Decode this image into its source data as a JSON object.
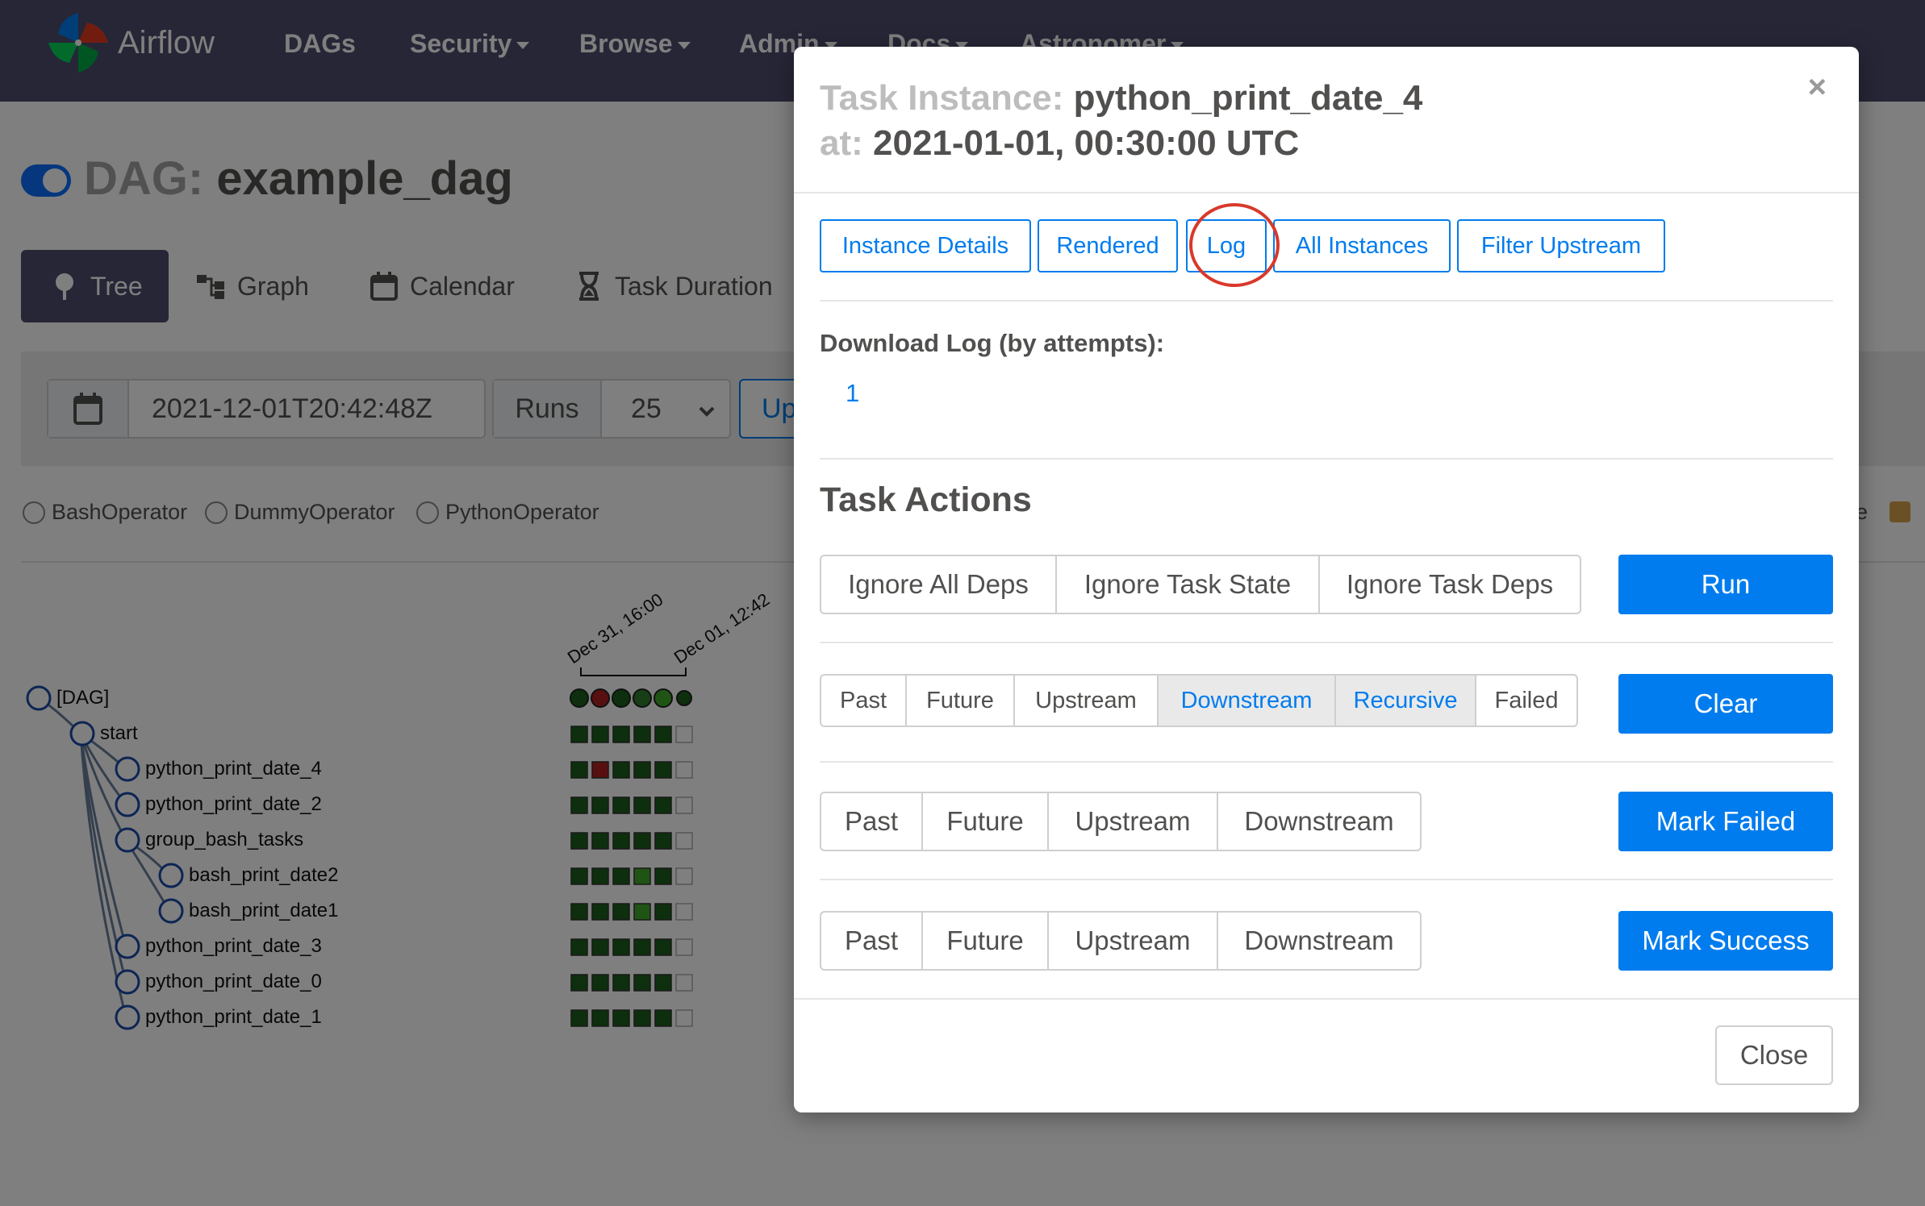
{
  "navbar": {
    "brand": "Airflow",
    "items": [
      "DAGs",
      "Security",
      "Browse",
      "Admin",
      "Docs",
      "Astronomer"
    ]
  },
  "dag": {
    "label": "DAG:",
    "name": "example_dag"
  },
  "views": [
    "Tree",
    "Graph",
    "Calendar",
    "Task Duration"
  ],
  "filter": {
    "base_date": "2021-12-01T20:42:48Z",
    "runs_label": "Runs",
    "runs_value": "25",
    "update_label": "Update"
  },
  "legend": [
    "BashOperator",
    "DummyOperator",
    "PythonOperator"
  ],
  "legend_right": "e",
  "tree": {
    "date_labels": [
      "Dec 31, 16:00",
      "Dec 01, 12:42"
    ],
    "nodes": [
      "[DAG]",
      "start",
      "python_print_date_4",
      "python_print_date_2",
      "group_bash_tasks",
      "bash_print_date2",
      "bash_print_date1",
      "python_print_date_3",
      "python_print_date_0",
      "python_print_date_1"
    ]
  },
  "colors": {
    "navbar": "#4c4d6e",
    "primary": "#017cee",
    "success": "#1a5f1a",
    "failed": "#b01f1f",
    "running": "#40a829",
    "annotation": "#d8392b"
  },
  "modal": {
    "title_label": "Task Instance:",
    "task_id": "python_print_date_4",
    "at_label": "at:",
    "execution_date": "2021-01-01, 00:30:00 UTC",
    "close_x": "×",
    "tabs": [
      "Instance Details",
      "Rendered",
      "Log",
      "All Instances",
      "Filter Upstream"
    ],
    "download_label": "Download Log (by attempts):",
    "attempts": [
      "1"
    ],
    "task_actions_title": "Task Actions",
    "run": {
      "options": [
        "Ignore All Deps",
        "Ignore Task State",
        "Ignore Task Deps"
      ],
      "button": "Run"
    },
    "clear": {
      "options": [
        "Past",
        "Future",
        "Upstream",
        "Downstream",
        "Recursive",
        "Failed"
      ],
      "active": [
        "Downstream",
        "Recursive"
      ],
      "button": "Clear"
    },
    "mark_failed": {
      "options": [
        "Past",
        "Future",
        "Upstream",
        "Downstream"
      ],
      "button": "Mark Failed"
    },
    "mark_success": {
      "options": [
        "Past",
        "Future",
        "Upstream",
        "Downstream"
      ],
      "button": "Mark Success"
    },
    "close_button": "Close"
  }
}
